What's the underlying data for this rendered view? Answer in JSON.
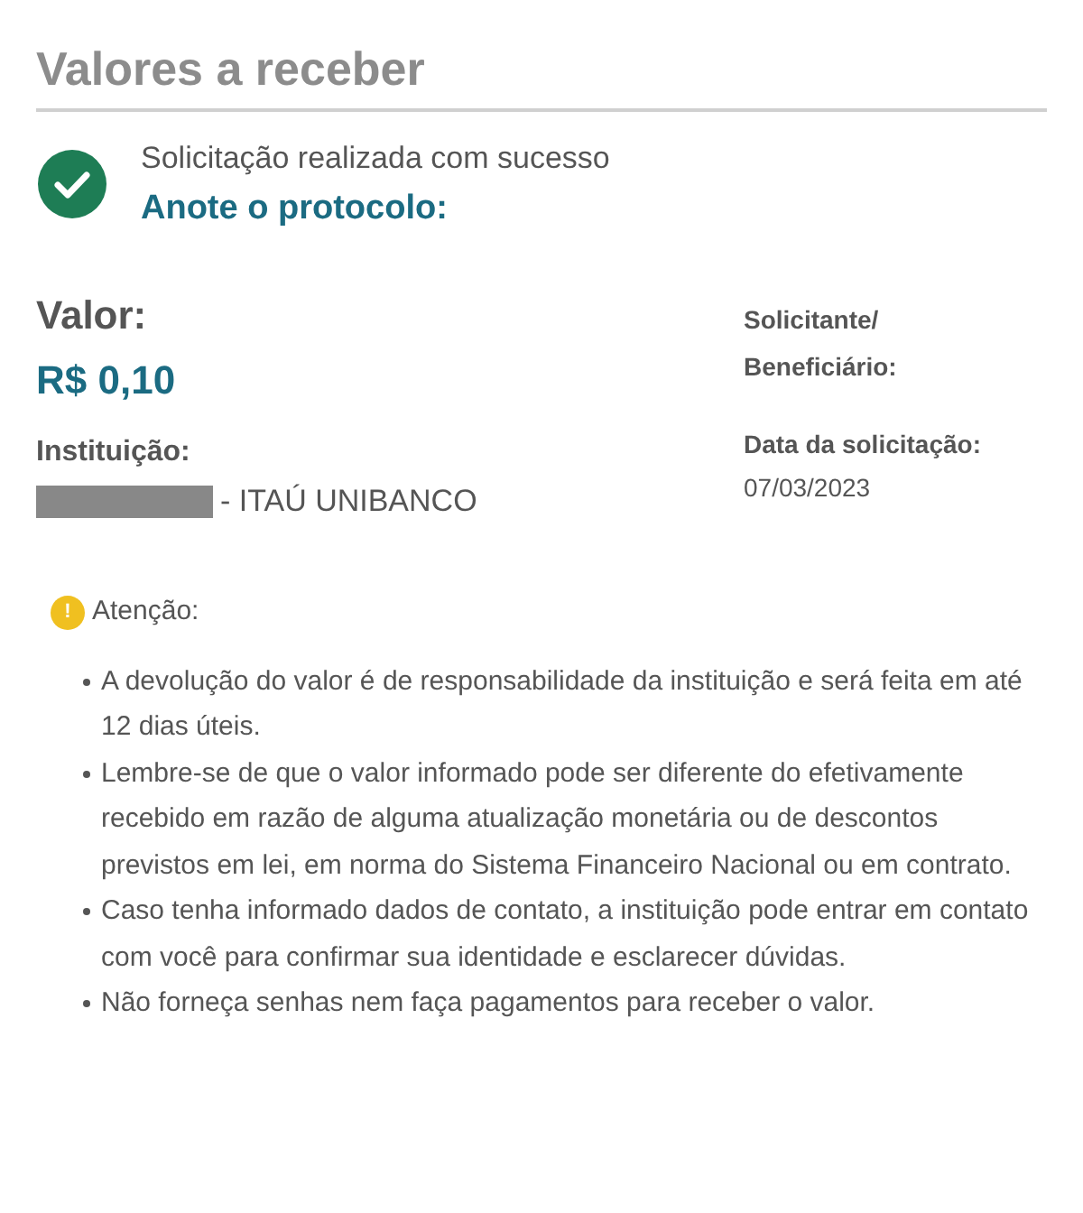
{
  "title": "Valores a receber",
  "success": {
    "message": "Solicitação realizada com sucesso",
    "protocol_label": "Anote o protocolo:"
  },
  "valor": {
    "label": "Valor:",
    "amount": "R$ 0,10"
  },
  "instituicao": {
    "label": "Instituição:",
    "value": "- ITAÚ UNIBANCO",
    "redacted": true
  },
  "solicitante": {
    "label": "Solicitante/ Beneficiário:"
  },
  "data_solicitacao": {
    "label": "Data da solicitação:",
    "value": "07/03/2023"
  },
  "attention": {
    "title": "Atenção:",
    "icon_glyph": "!",
    "items": [
      "A devolução do valor é de responsabilidade da instituição e será feita em até 12 dias úteis.",
      "Lembre-se de que o valor informado pode ser diferente do efetivamente recebido em razão de alguma atualização monetária ou de descontos previstos em lei, em norma do Sistema Financeiro Nacional ou em contrato.",
      "Caso tenha informado dados de contato, a instituição pode entrar em contato com você para confirmar sua identidade e esclarecer dúvidas.",
      "Não forneça senhas nem faça pagamentos para receber o valor."
    ]
  }
}
